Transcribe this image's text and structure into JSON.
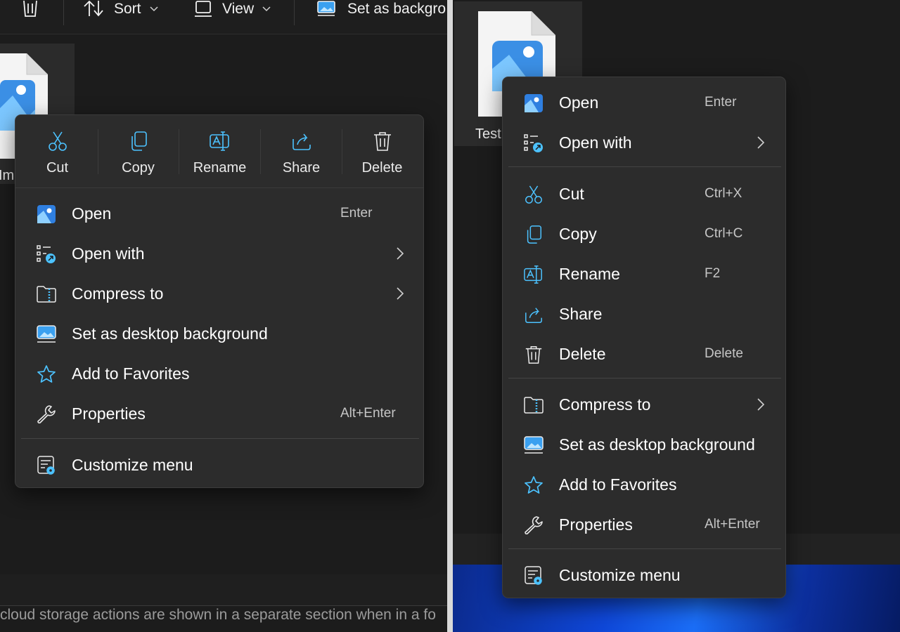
{
  "left": {
    "toolbar": {
      "sort_label": "Sort",
      "view_label": "View",
      "set_bg_label": "Set as backgro"
    },
    "file_label": "Im",
    "status_text": "cloud storage actions are shown in a separate section when in a fo",
    "menu": {
      "quick_actions": [
        {
          "label": "Cut",
          "icon": "cut-icon"
        },
        {
          "label": "Copy",
          "icon": "copy-icon"
        },
        {
          "label": "Rename",
          "icon": "rename-icon"
        },
        {
          "label": "Share",
          "icon": "share-icon"
        },
        {
          "label": "Delete",
          "icon": "delete-icon"
        }
      ],
      "items": [
        {
          "label": "Open",
          "accel": "Enter",
          "icon": "photos-app-icon"
        },
        {
          "label": "Open with",
          "accel": "",
          "icon": "open-with-icon",
          "submenu": true
        },
        {
          "label": "Compress to",
          "accel": "",
          "icon": "compress-icon",
          "submenu": true
        },
        {
          "label": "Set as desktop background",
          "accel": "",
          "icon": "desktop-background-icon"
        },
        {
          "label": "Add to Favorites",
          "accel": "",
          "icon": "star-icon"
        },
        {
          "label": "Properties",
          "accel": "Alt+Enter",
          "icon": "wrench-icon"
        }
      ],
      "footer": {
        "label": "Customize menu",
        "icon": "customize-icon"
      }
    }
  },
  "right": {
    "file_label": "Test",
    "menu": {
      "group1": [
        {
          "label": "Open",
          "accel": "Enter",
          "icon": "photos-app-icon"
        },
        {
          "label": "Open with",
          "accel": "",
          "icon": "open-with-icon",
          "submenu": true
        }
      ],
      "group2": [
        {
          "label": "Cut",
          "accel": "Ctrl+X",
          "icon": "cut-icon"
        },
        {
          "label": "Copy",
          "accel": "Ctrl+C",
          "icon": "copy-icon"
        },
        {
          "label": "Rename",
          "accel": "F2",
          "icon": "rename-icon"
        },
        {
          "label": "Share",
          "accel": "",
          "icon": "share-icon"
        },
        {
          "label": "Delete",
          "accel": "Delete",
          "icon": "delete-icon"
        }
      ],
      "group3": [
        {
          "label": "Compress to",
          "accel": "",
          "icon": "compress-icon",
          "submenu": true
        },
        {
          "label": "Set as desktop background",
          "accel": "",
          "icon": "desktop-background-icon"
        },
        {
          "label": "Add to Favorites",
          "accel": "",
          "icon": "star-icon"
        },
        {
          "label": "Properties",
          "accel": "Alt+Enter",
          "icon": "wrench-icon"
        }
      ],
      "footer": {
        "label": "Customize menu",
        "icon": "customize-icon"
      }
    }
  },
  "colors": {
    "accent_blue": "#4cc2ff",
    "menu_bg": "#2c2c2c",
    "app_bg": "#1c1c1c"
  }
}
